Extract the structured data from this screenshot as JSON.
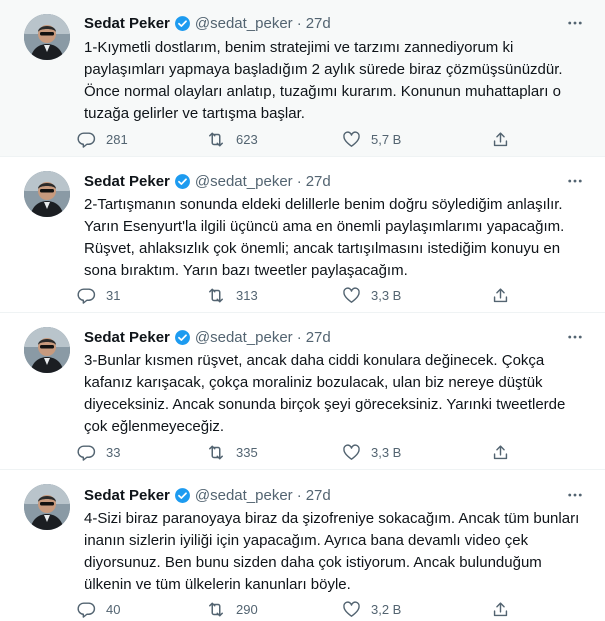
{
  "tweets": [
    {
      "name": "Sedat Peker",
      "handle": "@sedat_peker",
      "separator": "·",
      "time": "27d",
      "text": "1-Kıymetli dostlarım, benim stratejimi ve tarzımı zannediyorum ki paylaşımları yapmaya başladığım 2 aylık sürede biraz çözmüşsünüzdür. Önce normal olayları anlatıp, tuzağımı kurarım. Konunun muhattapları o tuzağa gelirler ve tartışma başlar.",
      "replies": "281",
      "retweets": "623",
      "likes": "5,7 B"
    },
    {
      "name": "Sedat Peker",
      "handle": "@sedat_peker",
      "separator": "·",
      "time": "27d",
      "text": "2-Tartışmanın sonunda eldeki delillerle benim doğru söylediğim anlaşılır. Yarın Esenyurt'la ilgili üçüncü ama en önemli paylaşımlarımı yapacağım. Rüşvet, ahlaksızlık çok önemli; ancak tartışılmasını istediğim konuyu en sona bıraktım. Yarın bazı tweetler paylaşacağım.",
      "replies": "31",
      "retweets": "313",
      "likes": "3,3 B"
    },
    {
      "name": "Sedat Peker",
      "handle": "@sedat_peker",
      "separator": "·",
      "time": "27d",
      "text": "3-Bunlar kısmen rüşvet, ancak daha ciddi konulara değinecek. Çokça kafanız karışacak, çokça moraliniz bozulacak, ulan biz nereye düştük diyeceksiniz. Ancak sonunda birçok şeyi göreceksiniz. Yarınki tweetlerde çok eğlenmeyeceğiz.",
      "replies": "33",
      "retweets": "335",
      "likes": "3,3 B"
    },
    {
      "name": "Sedat Peker",
      "handle": "@sedat_peker",
      "separator": "·",
      "time": "27d",
      "text": "4-Sizi biraz paranoyaya biraz da şizofreniye sokacağım. Ancak tüm bunları inanın sizlerin iyiliği için yapacağım. Ayrıca bana devamlı video çek diyorsunuz. Ben bunu sizden daha çok istiyorum. Ancak bulunduğum ülkenin ve tüm ülkelerin kanunları böyle.",
      "replies": "40",
      "retweets": "290",
      "likes": "3,2 B"
    }
  ],
  "icons": {
    "verified": "verified-badge-icon",
    "more": "more-icon",
    "reply": "reply-icon",
    "retweet": "retweet-icon",
    "like": "like-icon",
    "share": "share-icon"
  },
  "colors": {
    "verified": "#1d9bf0",
    "secondary_text": "#536471",
    "first_tweet_bg": "#f7f9f9"
  }
}
